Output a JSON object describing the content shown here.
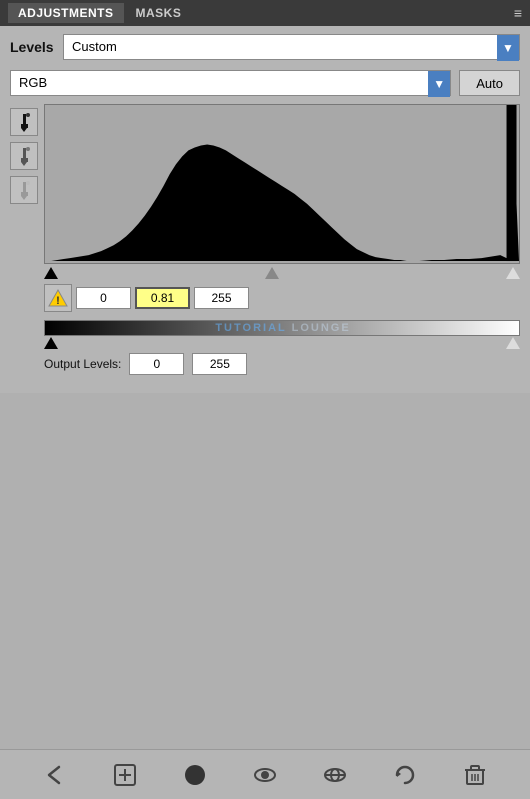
{
  "header": {
    "tabs": [
      {
        "label": "ADJUSTMENTS",
        "active": true
      },
      {
        "label": "MASKS",
        "active": false
      }
    ],
    "menu_icon": "≡"
  },
  "levels": {
    "label": "Levels",
    "preset": {
      "value": "Custom",
      "arrow": "▼"
    },
    "channel": {
      "value": "RGB",
      "arrow": "▼"
    },
    "auto_label": "Auto",
    "eyedroppers": [
      {
        "name": "black-point-eyedropper",
        "symbol": "🖊"
      },
      {
        "name": "gray-point-eyedropper",
        "symbol": "🖊"
      },
      {
        "name": "white-point-eyedropper",
        "symbol": "🖊"
      }
    ],
    "input_values": {
      "black": "0",
      "midtone": "0.81",
      "white": "255"
    },
    "output_label": "Output Levels:",
    "output_values": {
      "black": "0",
      "white": "255"
    },
    "watermark": {
      "part1": "TUTORIAL",
      "part2": " LOUNGE"
    }
  },
  "toolbar": {
    "buttons": [
      {
        "name": "back-button",
        "symbol": "↩"
      },
      {
        "name": "clip-button",
        "symbol": "⊡"
      },
      {
        "name": "circle-button",
        "symbol": "●"
      },
      {
        "name": "eye-button",
        "symbol": "👁"
      },
      {
        "name": "link-button",
        "symbol": "⊙"
      },
      {
        "name": "refresh-button",
        "symbol": "↺"
      },
      {
        "name": "delete-button",
        "symbol": "🗑"
      }
    ]
  }
}
